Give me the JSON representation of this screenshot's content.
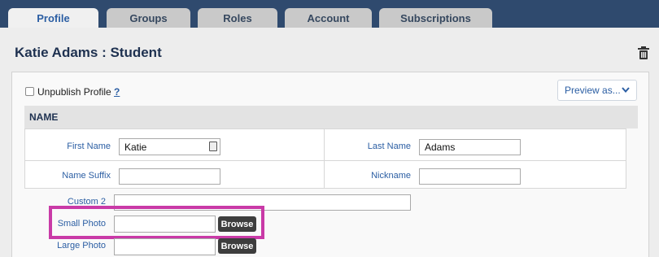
{
  "tabs": [
    {
      "label": "Profile",
      "active": true
    },
    {
      "label": "Groups",
      "active": false
    },
    {
      "label": "Roles",
      "active": false
    },
    {
      "label": "Account",
      "active": false
    },
    {
      "label": "Subscriptions",
      "active": false
    }
  ],
  "page": {
    "title": "Katie Adams : Student"
  },
  "options": {
    "unpublish_label": "Unpublish Profile",
    "help_label": "?",
    "preview_label": "Preview as..."
  },
  "section": {
    "name_header": "NAME"
  },
  "fields": {
    "first_name": {
      "label": "First Name",
      "value": "Katie"
    },
    "last_name": {
      "label": "Last Name",
      "value": "Adams"
    },
    "name_suffix": {
      "label": "Name Suffix",
      "value": ""
    },
    "nickname": {
      "label": "Nickname",
      "value": ""
    },
    "custom2": {
      "label": "Custom 2",
      "value": ""
    },
    "small_photo": {
      "label": "Small Photo",
      "value": "",
      "button": "Browse"
    },
    "large_photo": {
      "label": "Large Photo",
      "value": "",
      "button": "Browse"
    }
  },
  "colors": {
    "accent": "#2b5ea3",
    "header_bg": "#2f4a6e",
    "highlight": "#c93aa7"
  },
  "icons": [
    "trash-icon",
    "chevron-down-icon",
    "contact-card-icon"
  ]
}
